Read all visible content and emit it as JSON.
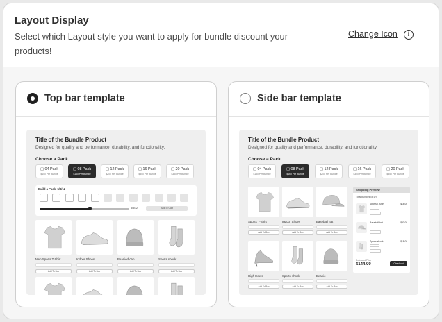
{
  "header": {
    "title": "Layout Display",
    "description": "Select which Layout style you want to apply for bundle discount your products!",
    "change_icon_label": "Change Icon",
    "info_glyph": "i"
  },
  "options": [
    {
      "label": "Top bar template",
      "selected": true
    },
    {
      "label": "Side bar template",
      "selected": false
    }
  ],
  "preview": {
    "title": "Title of the Bundle Product",
    "subtitle": "Designed for quality and performance, durability, and functionality.",
    "choose_label": "Choose a Pack",
    "packs": [
      {
        "name": "04 Pack",
        "price": "$150 Per Bundle"
      },
      {
        "name": "08 Pack",
        "price": "$160 Per Bundle",
        "selected": true
      },
      {
        "name": "12 Pack",
        "price": "$200 Per Bundle"
      },
      {
        "name": "16 Pack",
        "price": "$300 Per Bundle"
      },
      {
        "name": "20 Pack",
        "price": "$350 Per Bundle"
      }
    ],
    "builder_label": "Build a Pack: 5/8/12",
    "builder_progress_text": "5/8/12",
    "add_to_cart": "Add To Cart",
    "add_to_box": "Add To Box",
    "top_products": [
      "Men Sports T-Shirt",
      "Indoor Shoes",
      "Beanied cap",
      "Sports shock"
    ],
    "side_products": [
      "Sports T-Shirt",
      "Indoor Shoes",
      "Baseball hat",
      "High Heels",
      "Sports shock",
      "Beanie"
    ],
    "side_panel": {
      "header": "Shopping Preview",
      "subtitle": "Total Bundles (8/17)",
      "items": [
        {
          "name": "Sports T-Shirt",
          "price": "$18.00"
        },
        {
          "name": "Baseball hat",
          "price": "$20.00"
        },
        {
          "name": "Sports shock",
          "price": "$18.00"
        }
      ],
      "estimated_label": "Estimated Price",
      "total": "$144.00",
      "checkout": "Checkout"
    }
  },
  "colors": {
    "selected": "#2b2b2b",
    "border": "#cfcfcf",
    "background": "#f6f6f6"
  },
  "icons": [
    "info-icon",
    "radio-selected-icon",
    "radio-empty-icon",
    "bag-icon",
    "tshirt-icon",
    "shoe-icon",
    "cap-icon",
    "beanie-icon",
    "sock-icon",
    "heel-icon"
  ]
}
